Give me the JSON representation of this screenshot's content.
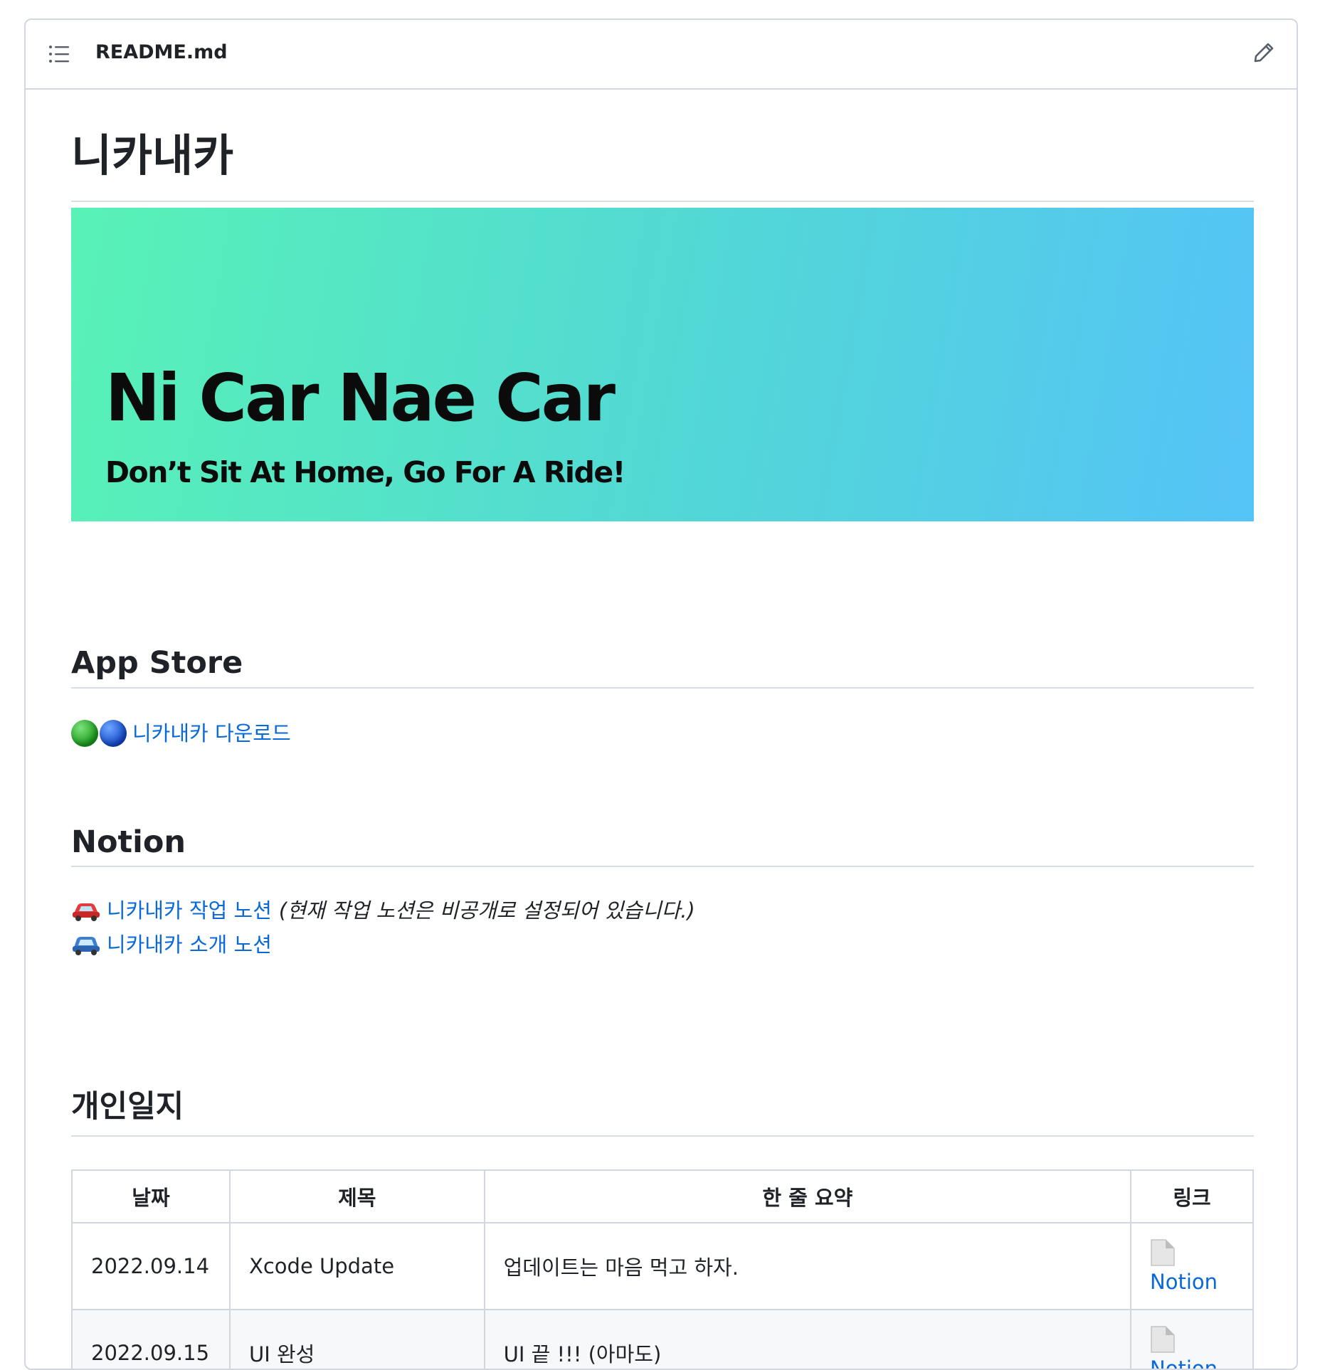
{
  "header": {
    "file_name": "README.md"
  },
  "title": "니카내카",
  "banner": {
    "title": "Ni Car Nae Car",
    "subtitle": "Don’t Sit At Home, Go For A Ride!"
  },
  "app_store": {
    "heading": "App Store",
    "link_label": "니카내카 다운로드"
  },
  "notion": {
    "heading": "Notion",
    "work_link": "니카내카 작업 노션",
    "work_note": "(현재 작업 노션은 비공개로 설정되어 있습니다.)",
    "intro_link": "니카내카 소개 노션"
  },
  "journal": {
    "heading": "개인일지",
    "columns": [
      "날짜",
      "제목",
      "한 줄 요약",
      "링크"
    ],
    "rows": [
      {
        "date": "2022.09.14",
        "title": "Xcode Update",
        "summary": "업데이트는 마음 먹고 하자.",
        "link": "Notion"
      },
      {
        "date": "2022.09.15",
        "title": "UI 완성",
        "summary": "UI 끝 !!! (아마도)",
        "link": "Notion"
      }
    ]
  },
  "colors": {
    "link": "#0969da",
    "border": "#d0d7de",
    "banner_start": "#58f2b6",
    "banner_end": "#55c3f7"
  },
  "icons": {
    "toc": "list-icon",
    "edit": "pencil-icon",
    "status_dots": [
      "green-circle-icon",
      "blue-circle-icon"
    ],
    "cars": [
      "red-car-icon",
      "blue-car-icon"
    ],
    "doc": "document-icon"
  }
}
